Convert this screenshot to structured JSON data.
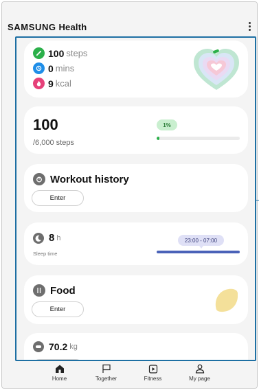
{
  "header": {
    "brand_part1": "SAMSUNG",
    "brand_part2": "Health",
    "more_icon": "more-vertical-icon"
  },
  "activity": {
    "steps": {
      "value": "100",
      "unit": "steps",
      "icon": "walk-icon",
      "color": "#2bb04a"
    },
    "mins": {
      "value": "0",
      "unit": "mins",
      "icon": "clock-icon",
      "color": "#1f8ee8"
    },
    "kcal": {
      "value": "9",
      "unit": "kcal",
      "icon": "flame-icon",
      "color": "#e6417a"
    }
  },
  "steps_card": {
    "value": "100",
    "goal": "/6,000 steps",
    "percent_label": "1%",
    "progress": 0.0167
  },
  "workout": {
    "title": "Workout history",
    "button": "Enter",
    "icon": "stopwatch-icon"
  },
  "sleep": {
    "value": "8",
    "unit": "h",
    "label": "Sleep time",
    "range": "23:00 - 07:00",
    "icon": "moon-icon"
  },
  "food": {
    "title": "Food",
    "button": "Enter",
    "icon": "utensils-icon"
  },
  "weight": {
    "value": "70.2",
    "unit": "kg",
    "icon": "scale-icon"
  },
  "nav": {
    "home": "Home",
    "together": "Together",
    "fitness": "Fitness",
    "mypage": "My page"
  },
  "colors": {
    "highlight": "#1d6fa3",
    "accent": "#2bb04a",
    "sleep": "#4a62b8"
  }
}
